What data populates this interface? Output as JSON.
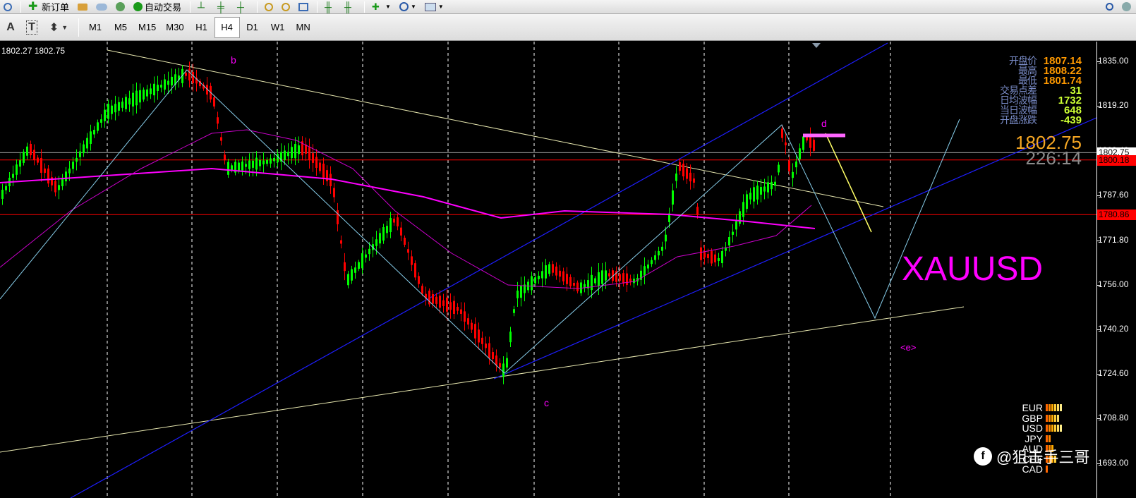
{
  "toolbar": {
    "new_order_label": "新订单",
    "auto_trade_label": "自动交易"
  },
  "timeframes": [
    "M1",
    "M5",
    "M15",
    "M30",
    "H1",
    "H4",
    "D1",
    "W1",
    "MN"
  ],
  "active_timeframe": "H4",
  "chart": {
    "symbol_label": "XAUUSD",
    "bid_ask": "1802.27 1802.75",
    "big_price": "1802.75",
    "countdown": "226:14",
    "wave_labels": {
      "b": "b",
      "c": "c",
      "d": "d",
      "e": "<e>"
    },
    "price_axis_ticks": [
      "1835.00",
      "1819.20",
      "1803.40",
      "1787.60",
      "1771.80",
      "1756.00",
      "1740.20",
      "1724.60",
      "1708.80",
      "1693.00"
    ],
    "current_price_tag": "1802.75",
    "red_line_tags": [
      "1800.18",
      "1780.86"
    ],
    "colors": {
      "bull_candle": "#00ff00",
      "bear_candle": "#ff0000",
      "ma_fast": "#ff00ff",
      "ma_slow": "#cc00cc",
      "channel": "#1e1eff",
      "trendline": "#e8e8b0",
      "wave_line": "#87ceeb",
      "projection_yellow": "#ffff66"
    }
  },
  "stats": [
    {
      "label": "开盘价",
      "value": "1807.14",
      "color": "#ff9900"
    },
    {
      "label": "最高",
      "value": "1808.22",
      "color": "#ff9900"
    },
    {
      "label": "最低",
      "value": "1801.74",
      "color": "#ff9900"
    },
    {
      "label": "交易点差",
      "value": "31",
      "color": "#ccff33"
    },
    {
      "label": "日均波幅",
      "value": "1732",
      "color": "#ccff33"
    },
    {
      "label": "当日波幅",
      "value": "648",
      "color": "#ccff33"
    },
    {
      "label": "开盘涨跌",
      "value": "-439",
      "color": "#ccff33"
    }
  ],
  "currencies": [
    {
      "name": "EUR",
      "bars": 6
    },
    {
      "name": "GBP",
      "bars": 5
    },
    {
      "name": "USD",
      "bars": 6
    },
    {
      "name": "JPY",
      "bars": 2
    },
    {
      "name": "AUD",
      "bars": 3
    },
    {
      "name": "CHF",
      "bars": 4
    },
    {
      "name": "CAD",
      "bars": 1
    }
  ],
  "watermark": "@狙击手三哥"
}
